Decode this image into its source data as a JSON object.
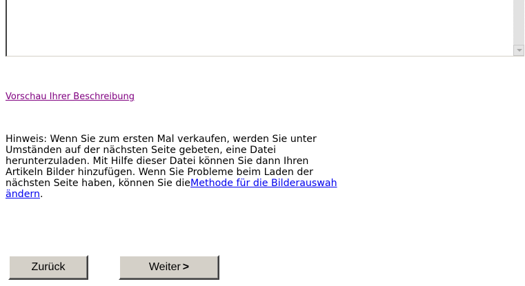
{
  "description_field": {
    "value": ""
  },
  "preview": {
    "link_label": "Vorschau Ihrer Beschreibung"
  },
  "notice": {
    "line1": "Hinweis: Wenn Sie zum ersten Mal verkaufen, werden Sie unter",
    "line2": "Umständen auf der nächsten Seite gebeten, eine Datei",
    "line3": "herunterzuladen. Mit Hilfe dieser Datei können Sie dann Ihren",
    "line4": "Artikeln Bilder hinzufügen. Wenn Sie Probleme beim Laden der",
    "line5_text": "nächsten Seite haben, können Sie die",
    "line5_link": "Methode für die Bilderauswah",
    "line6_link": "ändern",
    "line6_end": "."
  },
  "buttons": {
    "back_label": "Zurück",
    "next_label": "Weiter",
    "next_chevron": ">"
  },
  "colors": {
    "visited_link": "#800080",
    "link": "#0000ee",
    "button_face": "#d4d0c8"
  },
  "icons": {
    "scroll_down": "scroll-down-arrow-icon"
  }
}
